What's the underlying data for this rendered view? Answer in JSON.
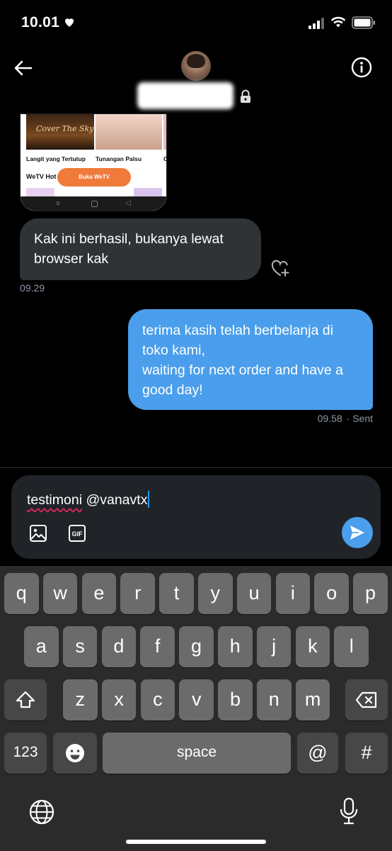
{
  "status_bar": {
    "time": "10.01",
    "icons": [
      "heart-icon",
      "cellular-signal-icon",
      "wifi-icon",
      "battery-icon"
    ]
  },
  "header": {
    "icons": [
      "back-arrow-icon",
      "avatar",
      "lock-icon",
      "info-icon"
    ]
  },
  "media_card": {
    "poster_title": "Cover The Sky",
    "captions": [
      "Langit yang Tertutup",
      "Tunangan Palsu",
      "C"
    ],
    "section_label": "WeTV Hot",
    "button_label": "Buka WeTV"
  },
  "messages": {
    "received": {
      "text": "Kak ini berhasil, bukanya lewat browser kak",
      "time": "09.29"
    },
    "sent": {
      "text": "terima kasih telah berbelanja di toko kami,\nwaiting for next order and have a good day!",
      "time": "09.58",
      "status": "· Sent"
    }
  },
  "compose": {
    "word_misspelled": "testimoni",
    "word_rest": " @vanavtx",
    "gif_label": "GIF"
  },
  "keyboard": {
    "row1": [
      "q",
      "w",
      "e",
      "r",
      "t",
      "y",
      "u",
      "i",
      "o",
      "p"
    ],
    "row2": [
      "a",
      "s",
      "d",
      "f",
      "g",
      "h",
      "j",
      "k",
      "l"
    ],
    "row3": [
      "z",
      "x",
      "c",
      "v",
      "b",
      "n",
      "m"
    ],
    "numbers_label": "123",
    "space_label": "space",
    "at_label": "@",
    "hash_label": "#"
  },
  "colors": {
    "background": "#000000",
    "received_bubble": "#2f3336",
    "sent_bubble": "#4a9eeb",
    "compose_bg": "#202327",
    "keyboard_bg": "#2b2b2b",
    "key": "#6b6b6b",
    "key_dark": "#474747",
    "timestamp": "#8b98a5",
    "caret": "#1d9bf0"
  }
}
